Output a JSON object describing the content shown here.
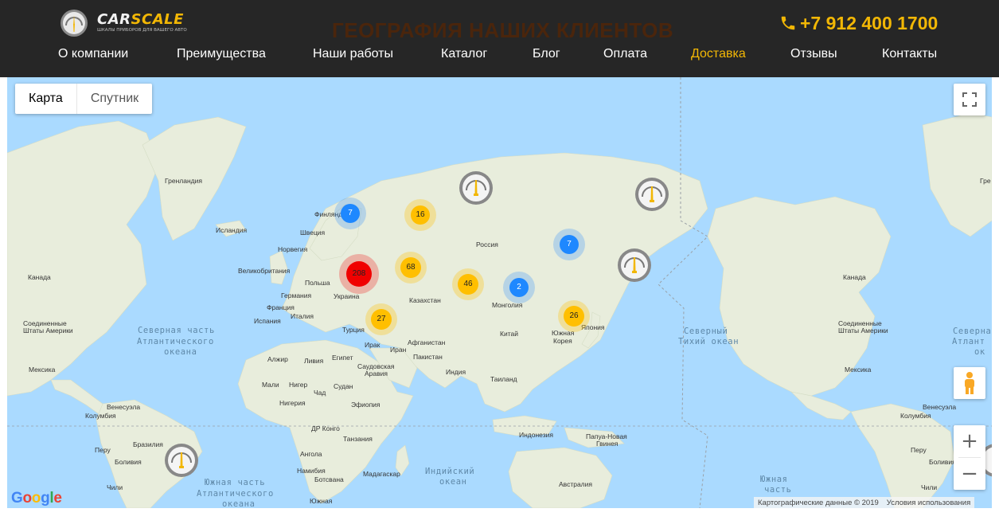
{
  "header": {
    "logo": {
      "name": "CARSCALE",
      "name_part1": "CAR",
      "name_part2": "SCALE",
      "tagline": "ШКАЛЫ ПРИБОРОВ ДЛЯ ВАШЕГО АВТО"
    },
    "page_title": "ГЕОГРАФИЯ НАШИХ КЛИЕНТОВ",
    "phone": "+7 912 400 1700",
    "nav": [
      {
        "label": "О компании",
        "active": false
      },
      {
        "label": "Преимущества",
        "active": false
      },
      {
        "label": "Наши работы",
        "active": false
      },
      {
        "label": "Каталог",
        "active": false
      },
      {
        "label": "Блог",
        "active": false
      },
      {
        "label": "Оплата",
        "active": false
      },
      {
        "label": "Доставка",
        "active": true
      },
      {
        "label": "Отзывы",
        "active": false
      },
      {
        "label": "Контакты",
        "active": false
      }
    ]
  },
  "map": {
    "map_type": {
      "map_label": "Карта",
      "satellite_label": "Спутник",
      "selected": "Карта"
    },
    "clusters": [
      {
        "count": "7",
        "color": "blue"
      },
      {
        "count": "16",
        "color": "yellow"
      },
      {
        "count": "208",
        "color": "red"
      },
      {
        "count": "68",
        "color": "yellow"
      },
      {
        "count": "46",
        "color": "yellow"
      },
      {
        "count": "7",
        "color": "blue"
      },
      {
        "count": "2",
        "color": "blue"
      },
      {
        "count": "27",
        "color": "yellow"
      },
      {
        "count": "26",
        "color": "yellow"
      }
    ],
    "labels": {
      "greenland": "Гренландия",
      "iceland": "Исландия",
      "finland": "Финляндия",
      "sweden": "Швеция",
      "norway": "Норвегия",
      "uk": "Великобритания",
      "poland": "Польша",
      "germany": "Германия",
      "france": "Франция",
      "spain": "Испания",
      "italy": "Италия",
      "ukraine": "Украина",
      "russia": "Россия",
      "kazakhstan": "Казахстан",
      "mongolia": "Монголия",
      "turkey": "Турция",
      "iraq": "Ирак",
      "iran": "Иран",
      "afghanistan": "Афганистан",
      "pakistan": "Пакистан",
      "india": "Индия",
      "china": "Китай",
      "japan": "Япония",
      "south_korea": "Южная Корея",
      "thailand": "Таиланд",
      "indonesia": "Indonesia",
      "png": "Папуа-Новая Гвинея",
      "australia": "Австралия",
      "algeria": "Алжир",
      "libya": "Ливия",
      "egypt": "Египет",
      "saudi": "Саудовская Аравия",
      "mali": "Мали",
      "niger": "Нигер",
      "chad": "Чад",
      "sudan": "Судан",
      "nigeria": "Нигерия",
      "ethiopia": "Эфиопия",
      "drc": "ДР Конго",
      "tanzania": "Танзания",
      "angola": "Ангола",
      "namibia": "Намибия",
      "botswana": "Ботсвана",
      "madagascar": "Мадагаскар",
      "south_africa": "Южная Африка",
      "canada": "Канада",
      "usa": "Соединенные Штаты Америки",
      "mexico": "Мексика",
      "venezuela": "Венесуэла",
      "colombia": "Колумбия",
      "brazil": "Бразилия",
      "peru": "Перу",
      "bolivia": "Боливия",
      "chile": "Чили",
      "canada_right": "Канада",
      "usa_right": "Соединенные Штаты Америки",
      "mexico_right": "Мексика",
      "venezuela_right": "Венесуэла",
      "colombia_right": "Колумбия",
      "peru_right": "Перу",
      "bolivia_right": "Боливия",
      "chile_right": "Чили",
      "greenland_right": "Гре"
    },
    "oceans": {
      "north_atlantic": [
        "Северная часть",
        "Атлантического",
        "океана"
      ],
      "north_pacific": [
        "Северный",
        "Тихий океан"
      ],
      "indian": [
        "Индийский",
        "океан"
      ],
      "south_atlantic": [
        "Южная часть",
        "Атлантического",
        "океана"
      ],
      "south_pacific": [
        "Южная",
        "часть"
      ],
      "north_atlantic_right": [
        "Северная",
        "Атлант",
        "ок"
      ]
    },
    "controls": {
      "zoom_in": "+",
      "zoom_out": "−"
    },
    "google_logo": "Google",
    "attribution": {
      "data": "Картографические данные © 2019",
      "terms": "Условия использования"
    }
  },
  "colors": {
    "header_bg": "#262626",
    "accent": "#f2b705",
    "title": "#4a250c",
    "water": "#aadaff",
    "land": "#e8eddc",
    "cluster_red": "#f00000",
    "cluster_yellow": "#ffbf00",
    "cluster_blue": "#1e88ff"
  }
}
